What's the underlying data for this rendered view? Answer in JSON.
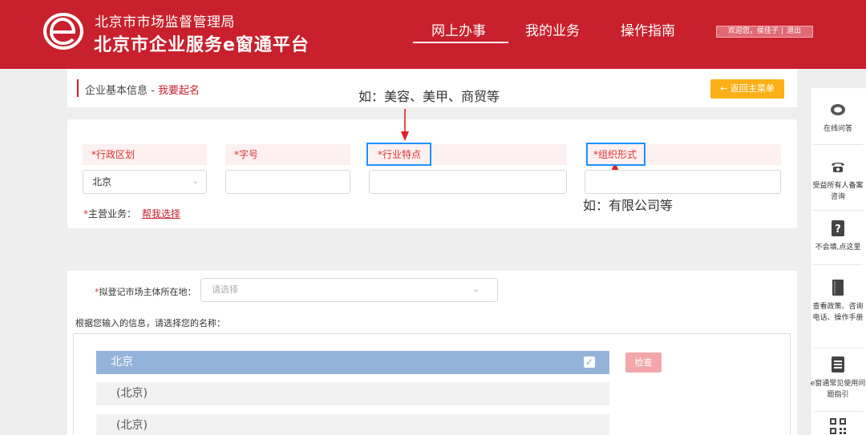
{
  "header": {
    "org_name": "北京市市场监督管理局",
    "platform_name": "北京市企业服务e窗通平台",
    "nav": [
      "网上办事",
      "我的业务",
      "操作指南"
    ],
    "welcome": "欢迎您，侯佳子",
    "logout": "退出"
  },
  "breadcrumb": {
    "section": "企业基本信息",
    "separator": " - ",
    "current": "我要起名"
  },
  "back_button": "← 返回主菜单",
  "annotations": {
    "industry_hint": "如：美容、美甲、商贸等",
    "org_form_hint": "如：有限公司等"
  },
  "form": {
    "region_label": "*行政区划",
    "region_value": "北京",
    "brand_label": "*字号",
    "industry_label": "*行业特点",
    "org_form_label": "*组织形式",
    "main_business_req": "*",
    "main_business_label": "主营业务：",
    "help_link": "帮我选择",
    "location_req": "*",
    "location_label": "拟登记市场主体所在地：",
    "location_placeholder": "请选择",
    "choose_name_label": "根据您输入的信息，请选择您的名称："
  },
  "name_options": {
    "selected": "北京",
    "others": [
      "(北京)",
      "(北京)"
    ],
    "check_button": "检查"
  },
  "side_panel": [
    {
      "icon": "chat-icon",
      "label": "在线问答"
    },
    {
      "icon": "phone-icon",
      "label": "受益所有人备案咨询"
    },
    {
      "icon": "question-icon",
      "label": "不会填,点这里"
    },
    {
      "icon": "book-icon",
      "label": "查看政策、咨询电话、操作手册"
    },
    {
      "icon": "list-icon",
      "label": "e窗通常见使用问题指引"
    },
    {
      "icon": "qr-code-icon",
      "label": ""
    }
  ],
  "colors": {
    "brand_red": "#c8202c",
    "annotation_blue": "#1e90ff",
    "selected_row": "#94b3da",
    "back_button": "#fbb018"
  }
}
